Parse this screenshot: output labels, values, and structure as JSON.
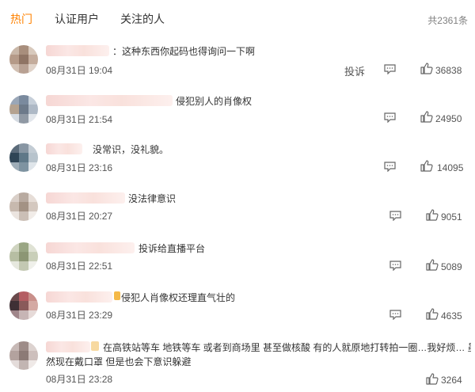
{
  "tabs": {
    "hot": "热门",
    "verified": "认证用户",
    "following": "关注的人",
    "total": "共2361条"
  },
  "report_label": "投诉",
  "colors": {
    "accent": "#ff8200",
    "text": "#333333",
    "muted": "#808080"
  },
  "icons": {
    "comment": "comment-bubble-icon",
    "like": "thumbs-up-icon"
  },
  "comments": [
    {
      "text": "：这种东西你起码也得询问一下啊",
      "time": "08月31日 19:04",
      "likes": "36838"
    },
    {
      "text": "侵犯别人的肖像权",
      "time": "08月31日 21:54",
      "likes": "24950"
    },
    {
      "text": "没常识，没礼貌。",
      "time": "08月31日 23:16",
      "likes": "14095"
    },
    {
      "text": "没法律意识",
      "time": "08月31日 20:27",
      "likes": "9051"
    },
    {
      "text": "投诉给直播平台",
      "time": "08月31日 22:51",
      "likes": "5089"
    },
    {
      "text": "侵犯人肖像权还理直气壮的",
      "time": "08月31日 23:29",
      "likes": "4635"
    },
    {
      "text": "在高铁站等车 地铁等车 或者到商场里 甚至做核酸 有的人就原地打转拍一圈…我好烦… 虽",
      "text_line2": "然现在戴口罩 但是也会下意识躲避",
      "time": "08月31日 23:28",
      "likes": "3264"
    }
  ]
}
